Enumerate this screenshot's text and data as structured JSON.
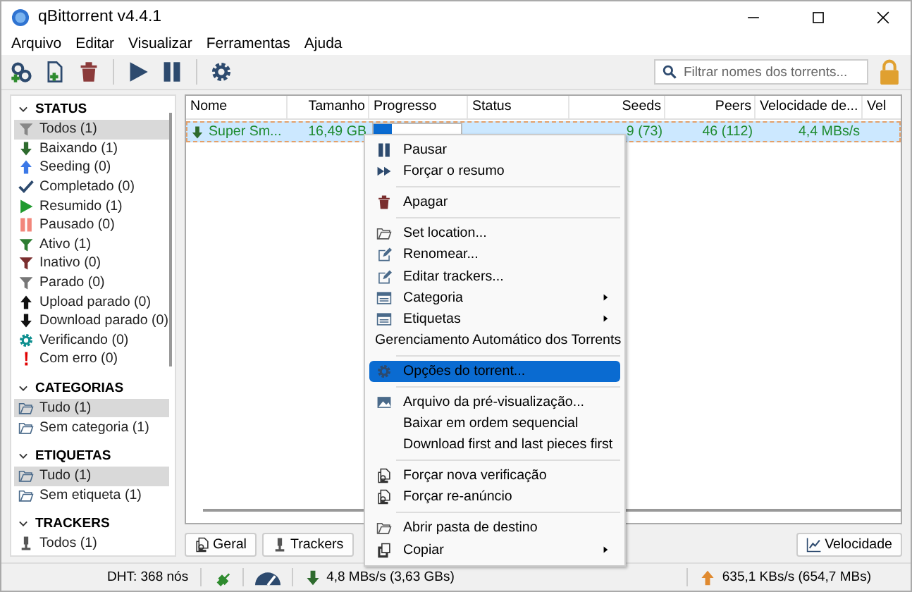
{
  "window": {
    "title": "qBittorrent v4.4.1"
  },
  "menu_bar": [
    "Arquivo",
    "Editar",
    "Visualizar",
    "Ferramentas",
    "Ajuda"
  ],
  "search": {
    "placeholder": "Filtrar nomes dos torrents..."
  },
  "sidebar": [
    {
      "title": "STATUS",
      "expanded": true,
      "items": [
        {
          "label": "Todos (1)",
          "selected": true
        },
        {
          "label": "Baixando (1)",
          "selected": false
        },
        {
          "label": "Seeding (0)",
          "selected": false
        },
        {
          "label": "Completado (0)",
          "selected": false
        },
        {
          "label": "Resumido (1)",
          "selected": false
        },
        {
          "label": "Pausado (0)",
          "selected": false
        },
        {
          "label": "Ativo (1)",
          "selected": false
        },
        {
          "label": "Inativo (0)",
          "selected": false
        },
        {
          "label": "Parado (0)",
          "selected": false
        },
        {
          "label": "Upload parado (0)",
          "selected": false
        },
        {
          "label": "Download parado (0)",
          "selected": false
        },
        {
          "label": "Verificando (0)",
          "selected": false
        },
        {
          "label": "Com erro (0)",
          "selected": false
        }
      ]
    },
    {
      "title": "CATEGORIAS",
      "expanded": true,
      "items": [
        {
          "label": "Tudo (1)",
          "selected": true
        },
        {
          "label": "Sem categoria (1)",
          "selected": false
        }
      ]
    },
    {
      "title": "ETIQUETAS",
      "expanded": true,
      "items": [
        {
          "label": "Tudo (1)",
          "selected": true
        },
        {
          "label": "Sem etiqueta (1)",
          "selected": false
        }
      ]
    },
    {
      "title": "TRACKERS",
      "expanded": true,
      "items": [
        {
          "label": "Todos (1)",
          "selected": false
        }
      ]
    }
  ],
  "table": {
    "columns": [
      "Nome",
      "Tamanho",
      "Progresso",
      "Status",
      "Seeds",
      "Peers",
      "Velocidade de...",
      "Vel"
    ],
    "rows": [
      {
        "name": "Super Sm...",
        "size": "16,49 GB",
        "level": 0.21,
        "seeds": "9 (73)",
        "peers": "46 (112)",
        "speed": "4,4 MBs/s",
        "selected": true
      }
    ]
  },
  "context_menu": [
    {
      "kind": "item",
      "label": "Pausar",
      "submenu": false,
      "selected": false
    },
    {
      "kind": "item",
      "label": "Forçar o resumo",
      "submenu": false,
      "selected": false
    },
    {
      "kind": "separator"
    },
    {
      "kind": "item",
      "label": "Apagar",
      "submenu": false,
      "selected": false
    },
    {
      "kind": "separator"
    },
    {
      "kind": "item",
      "label": "Set location...",
      "submenu": false,
      "selected": false
    },
    {
      "kind": "item",
      "label": "Renomear...",
      "submenu": false,
      "selected": false
    },
    {
      "kind": "item",
      "label": "Editar trackers...",
      "submenu": false,
      "selected": false
    },
    {
      "kind": "item",
      "label": "Categoria",
      "submenu": true,
      "selected": false
    },
    {
      "kind": "item",
      "label": "Etiquetas",
      "submenu": true,
      "selected": false
    },
    {
      "kind": "item",
      "label": "Gerenciamento Automático dos Torrents",
      "submenu": false,
      "selected": false
    },
    {
      "kind": "separator"
    },
    {
      "kind": "item",
      "label": "Opções do torrent...",
      "submenu": false,
      "selected": true
    },
    {
      "kind": "separator"
    },
    {
      "kind": "item",
      "label": "Arquivo da pré-visualização...",
      "submenu": false,
      "selected": false
    },
    {
      "kind": "item",
      "label": "Baixar em ordem sequencial",
      "submenu": false,
      "selected": false
    },
    {
      "kind": "item",
      "label": "Download first and last pieces first",
      "submenu": false,
      "selected": false
    },
    {
      "kind": "separator"
    },
    {
      "kind": "item",
      "label": "Forçar nova verificação",
      "submenu": false,
      "selected": false
    },
    {
      "kind": "item",
      "label": "Forçar re-anúncio",
      "submenu": false,
      "selected": false
    },
    {
      "kind": "separator"
    },
    {
      "kind": "item",
      "label": "Abrir pasta de destino",
      "submenu": false,
      "selected": false
    },
    {
      "kind": "item",
      "label": "Copiar",
      "submenu": true,
      "selected": false
    }
  ],
  "bottom_tabs": [
    "Geral",
    "Trackers"
  ],
  "speed_button": "Velocidade",
  "status_bar": {
    "dht": "DHT: 368 nós",
    "download": "4,8 MBs/s (3,63 GBs)",
    "upload": "635,1 KBs/s (654,7 MBs)"
  }
}
